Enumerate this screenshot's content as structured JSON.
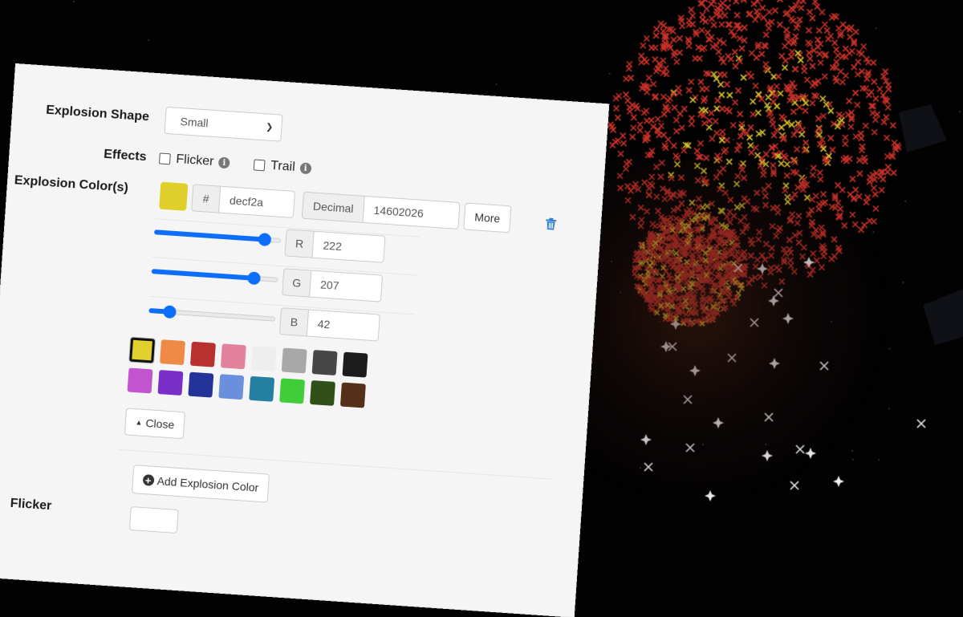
{
  "form": {
    "explosion_shape": {
      "label": "Explosion Shape",
      "selected": "Small",
      "icon": "chevron-down-icon"
    },
    "effects": {
      "label": "Effects",
      "options": [
        {
          "label": "Flicker",
          "checked": false,
          "info_icon": "info-icon"
        },
        {
          "label": "Trail",
          "checked": false,
          "info_icon": "info-icon"
        }
      ]
    },
    "explosion_colors": {
      "label": "Explosion Color(s)",
      "color": {
        "preview_hex": "#decf2a",
        "hex_prefix": "#",
        "hex_value": "decf2a",
        "decimal_label": "Decimal",
        "decimal_value": "14602026",
        "more_label": "More",
        "delete_icon": "trash-icon",
        "channels": [
          {
            "name": "R",
            "value": "222",
            "max": 255
          },
          {
            "name": "G",
            "value": "207",
            "max": 255
          },
          {
            "name": "B",
            "value": "42",
            "max": 255
          }
        ],
        "palette": [
          {
            "hex": "#e0cf2c",
            "selected": true
          },
          {
            "hex": "#ee8a45",
            "selected": false
          },
          {
            "hex": "#b8312f",
            "selected": false
          },
          {
            "hex": "#e2829d",
            "selected": false
          },
          {
            "hex": "#eeeeee",
            "selected": false
          },
          {
            "hex": "#a8a8a8",
            "selected": false
          },
          {
            "hex": "#474747",
            "selected": false
          },
          {
            "hex": "#1c1c1c",
            "selected": false
          },
          {
            "hex": "#c254d0",
            "selected": false
          },
          {
            "hex": "#7a2ec8",
            "selected": false
          },
          {
            "hex": "#24339a",
            "selected": false
          },
          {
            "hex": "#6a8fdc",
            "selected": false
          },
          {
            "hex": "#257fa0",
            "selected": false
          },
          {
            "hex": "#3fcd3a",
            "selected": false
          },
          {
            "hex": "#2f5018",
            "selected": false
          },
          {
            "hex": "#54301a",
            "selected": false
          }
        ],
        "close_label": "Close",
        "close_icon": "caret-up-icon"
      },
      "add_label": "Add Explosion Color",
      "add_icon": "plus-circle-icon"
    },
    "next_section_label": "Flicker"
  },
  "scene": {
    "colors": {
      "red": "#c8322a",
      "yellow": "#d9c52a",
      "white": "#f0f0f0"
    }
  }
}
